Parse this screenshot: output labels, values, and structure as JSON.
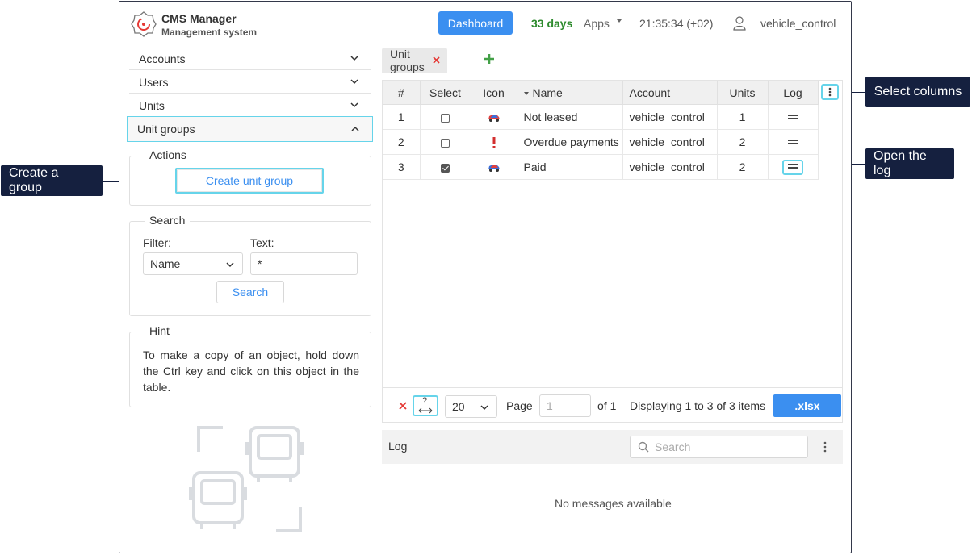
{
  "header": {
    "app_title": "CMS Manager",
    "app_subtitle": "Management system",
    "dashboard_label": "Dashboard",
    "days": "33 days",
    "apps_label": "Apps",
    "clock": "21:35:34 (+02)",
    "username": "vehicle_control"
  },
  "nav": {
    "items": [
      {
        "label": "Accounts"
      },
      {
        "label": "Users"
      },
      {
        "label": "Units"
      },
      {
        "label": "Unit groups"
      }
    ]
  },
  "actions": {
    "legend": "Actions",
    "create_label": "Create unit group"
  },
  "search": {
    "legend": "Search",
    "filter_label": "Filter:",
    "text_label": "Text:",
    "filter_value": "Name",
    "text_value": "*",
    "button_label": "Search"
  },
  "hint": {
    "legend": "Hint",
    "text": "To make a copy of an object, hold down the Ctrl key and click on this object in the table."
  },
  "tabs": [
    {
      "label": "Unit groups"
    }
  ],
  "table": {
    "columns": [
      "#",
      "Select",
      "Icon",
      "Name",
      "Account",
      "Units",
      "Log"
    ],
    "rows": [
      {
        "num": "1",
        "checked": false,
        "icon": "car-icon-blue-red",
        "name": "Not leased",
        "account": "vehicle_control",
        "units": "1"
      },
      {
        "num": "2",
        "checked": false,
        "icon": "exclamation-icon",
        "name": "Overdue payments",
        "account": "vehicle_control",
        "units": "2"
      },
      {
        "num": "3",
        "checked": true,
        "icon": "car-icon-red-blue",
        "name": "Paid",
        "account": "vehicle_control",
        "units": "2"
      }
    ]
  },
  "pager": {
    "page_size": "20",
    "help_mark": "?",
    "page_label": "Page",
    "page_value": "1",
    "of_label": "of 1",
    "displaying": "Displaying 1 to 3 of 3 items",
    "export_label": ".xlsx"
  },
  "log": {
    "title": "Log",
    "search_placeholder": "Search",
    "empty_text": "No messages available"
  },
  "callouts": {
    "create_group": "Create a group",
    "select_columns": "Select columns",
    "open_log": "Open the log"
  },
  "colors": {
    "accent": "#3b8ff0",
    "highlight": "#66d4ea",
    "callout_bg": "#15203f",
    "days_green": "#2e8b2e",
    "close_red": "#e53935",
    "add_green": "#43a047"
  }
}
